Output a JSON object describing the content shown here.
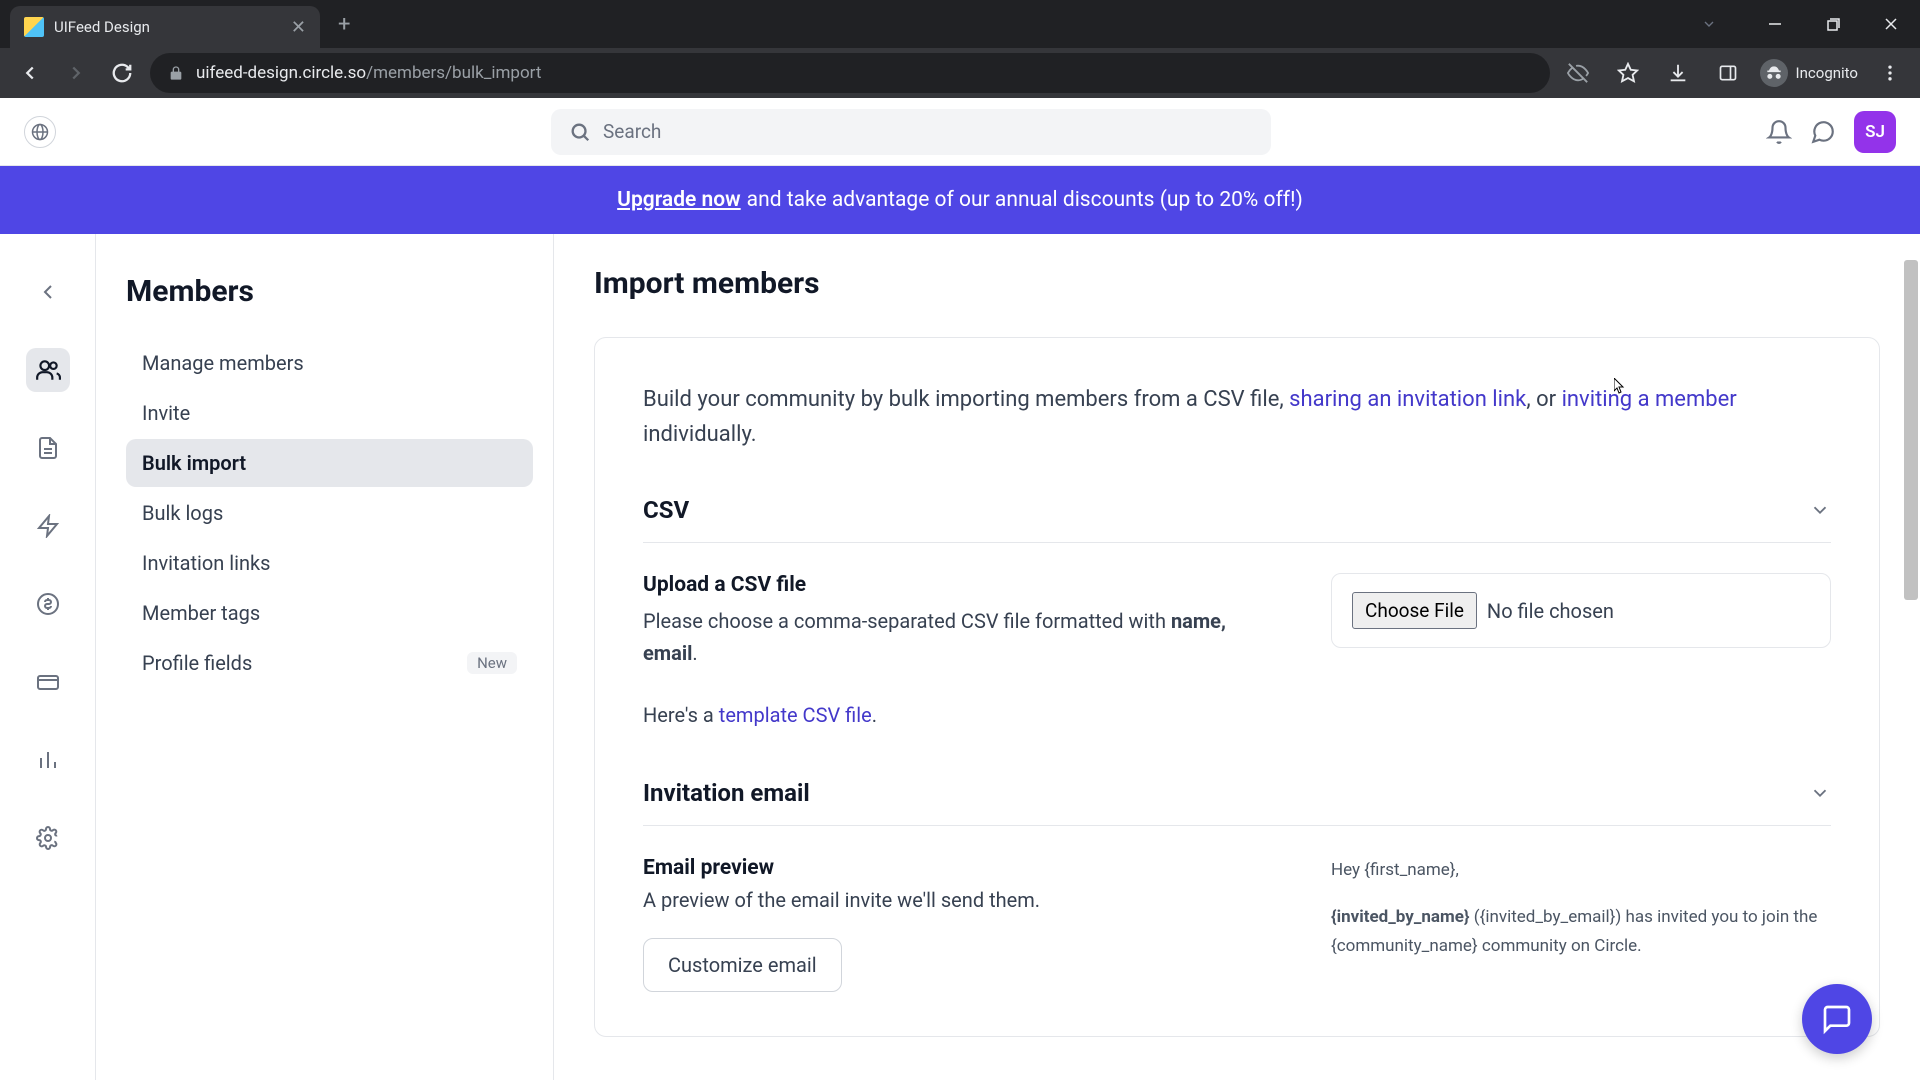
{
  "browser": {
    "tab_title": "UIFeed Design",
    "url_domain": "uifeed-design.circle.so",
    "url_path": "/members/bulk_import",
    "incognito_label": "Incognito"
  },
  "header": {
    "search_placeholder": "Search",
    "avatar_initials": "SJ"
  },
  "banner": {
    "link_text": "Upgrade now",
    "rest_text": " and take advantage of our annual discounts (up to 20% off!)"
  },
  "sidebar": {
    "title": "Members",
    "items": [
      {
        "label": "Manage members"
      },
      {
        "label": "Invite"
      },
      {
        "label": "Bulk import"
      },
      {
        "label": "Bulk logs"
      },
      {
        "label": "Invitation links"
      },
      {
        "label": "Member tags"
      },
      {
        "label": "Profile fields",
        "badge": "New"
      }
    ]
  },
  "content": {
    "page_title": "Import members",
    "intro_prefix": "Build your community by bulk importing members from a CSV file, ",
    "intro_link1": "sharing an invitation link",
    "intro_middle": ", or ",
    "intro_link2": "inviting a member",
    "intro_suffix": " individually.",
    "csv_heading": "CSV",
    "upload_heading": "Upload a CSV file",
    "upload_desc_prefix": "Please choose a comma-separated CSV file formatted with ",
    "upload_desc_bold": "name, email",
    "upload_desc_suffix": ".",
    "template_prefix": "Here's a ",
    "template_link": "template CSV file",
    "template_suffix": ".",
    "choose_file_label": "Choose File",
    "no_file_label": "No file chosen",
    "invitation_heading": "Invitation email",
    "preview_heading": "Email preview",
    "preview_desc": "A preview of the email invite we'll send them.",
    "customize_label": "Customize email",
    "email_body_line1": "Hey {first_name},",
    "email_body_line2a": "{invited_by_name}",
    "email_body_line2b": " ({invited_by_email}) has invited you to join the {community_name} community on Circle."
  }
}
